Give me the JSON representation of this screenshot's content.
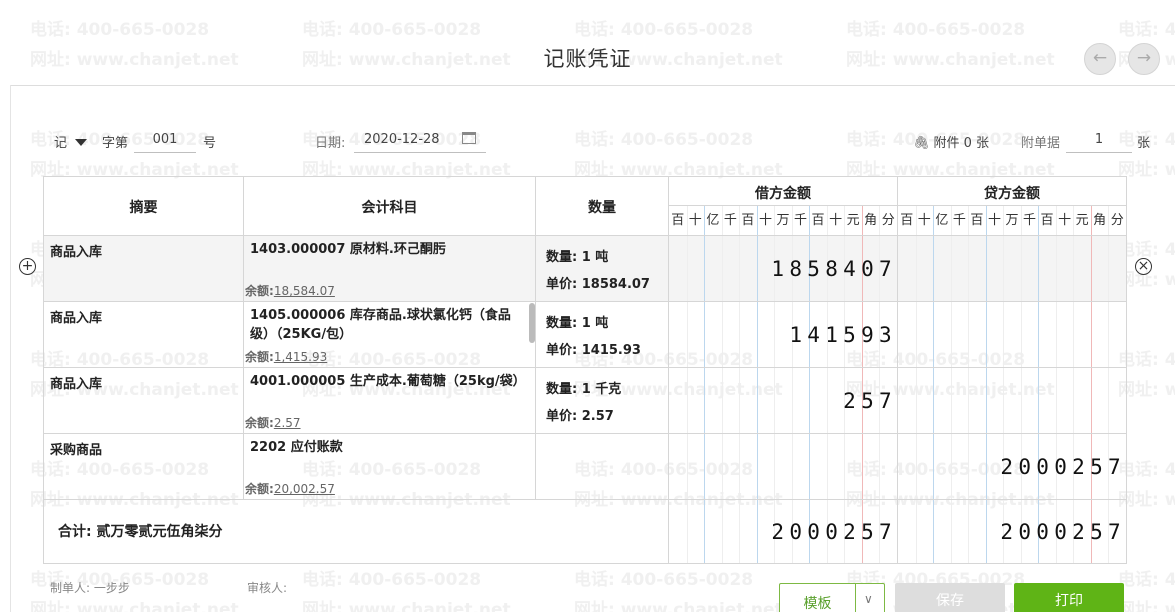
{
  "watermark": {
    "line1": "电话: 400-665-0028",
    "line2": "网址: www.chanjet.net"
  },
  "title": "记账凭证",
  "nav": {
    "prev_glyph": "←",
    "next_glyph": "→"
  },
  "header": {
    "voucher_type": "记",
    "word_label": "字第",
    "number": "001",
    "number_suffix": "号",
    "date_label": "日期:",
    "date": "2020-12-28",
    "attachment_label": "附件 0 张",
    "doc_count_label": "附单据",
    "doc_count": "1",
    "doc_count_unit": "张"
  },
  "table": {
    "columns": {
      "summary": "摘要",
      "account": "会计科目",
      "quantity": "数量",
      "debit": "借方金额",
      "credit": "贷方金额"
    },
    "digit_headers": [
      "百",
      "十",
      "亿",
      "千",
      "百",
      "十",
      "万",
      "千",
      "百",
      "十",
      "元",
      "角",
      "分"
    ],
    "rows": [
      {
        "summary": "商品入库",
        "account": "1403.000007 原材料.环己酮肟",
        "balance_label": "余额:",
        "balance": "18,584.07",
        "qty_line": "数量: 1 吨",
        "price_line": "单价: 18584.07",
        "debit": "1858407",
        "credit": ""
      },
      {
        "summary": "商品入库",
        "account": "1405.000006 库存商品.球状氯化钙（食品级）（25KG/包）",
        "balance_label": "余额:",
        "balance": "1,415.93",
        "qty_line": "数量: 1 吨",
        "price_line": "单价: 1415.93",
        "debit": "141593",
        "credit": ""
      },
      {
        "summary": "商品入库",
        "account": "4001.000005 生产成本.葡萄糖（25kg/袋）",
        "balance_label": "余额:",
        "balance": "2.57",
        "qty_line": "数量: 1 千克",
        "price_line": "单价: 2.57",
        "debit": "257",
        "credit": ""
      },
      {
        "summary": "采购商品",
        "account": "2202 应付账款",
        "balance_label": "余额:",
        "balance": "20,002.57",
        "qty_line": "",
        "price_line": "",
        "debit": "",
        "credit": "2000257"
      }
    ],
    "total": {
      "text": "合计:  贰万零贰元伍角柒分",
      "debit": "2000257",
      "credit": "2000257"
    }
  },
  "footer": {
    "maker_label": "制单人: 一步步",
    "reviewer_label": "审核人:",
    "template_button": "模板",
    "template_arrow": "∨",
    "save_button": "保存",
    "print_button": "打印"
  },
  "icons": {
    "add_row": "add-circle-icon",
    "delete_row": "close-circle-icon",
    "calendar": "calendar-icon",
    "attachment": "paperclip-icon"
  },
  "colors": {
    "accent_green": "#5fb416",
    "template_border": "#7db943",
    "disabled_gray": "#dddddd",
    "unit_line_red": "#f0b8b8",
    "digit_line_blue": "#bcd7ee"
  }
}
